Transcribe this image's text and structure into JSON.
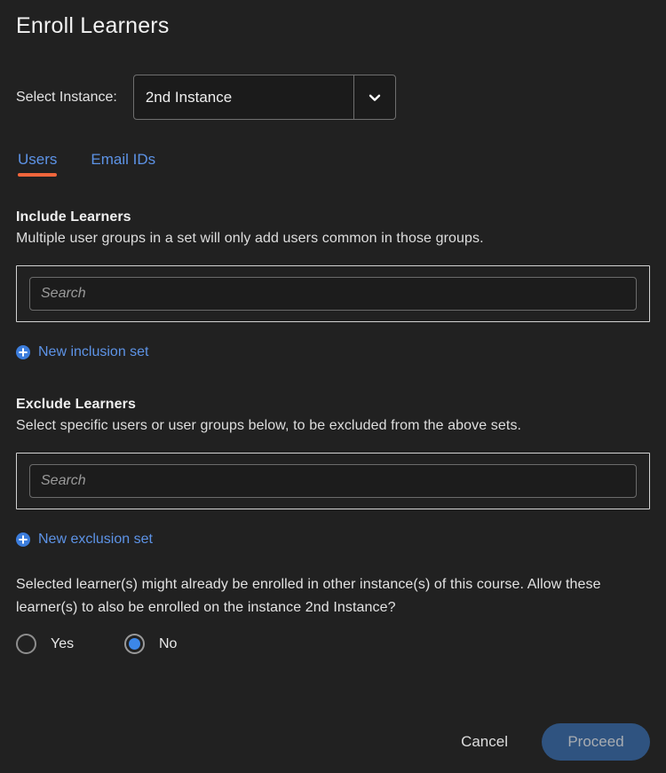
{
  "dialog": {
    "title": "Enroll Learners"
  },
  "instance": {
    "label": "Select Instance:",
    "selected": "2nd Instance",
    "arrow_icon": "chevron-down-icon"
  },
  "tabs": [
    {
      "label": "Users",
      "active": true
    },
    {
      "label": "Email IDs",
      "active": false
    }
  ],
  "include": {
    "heading": "Include Learners",
    "description": "Multiple user groups in a set will only add users common in those groups.",
    "search_placeholder": "Search",
    "search_value": "",
    "add_label": "New inclusion set",
    "add_icon": "plus-circle-icon"
  },
  "exclude": {
    "heading": "Exclude Learners",
    "description": "Select specific users or user groups below, to be excluded from the above sets.",
    "search_placeholder": "Search",
    "search_value": "",
    "add_label": "New exclusion set",
    "add_icon": "plus-circle-icon"
  },
  "allow_note": {
    "text": "Selected learner(s) might already be enrolled in other instance(s) of this course. Allow these learner(s) to also be enrolled on the instance 2nd Instance?",
    "options": [
      {
        "label": "Yes",
        "selected": false
      },
      {
        "label": "No",
        "selected": true
      }
    ]
  },
  "footer": {
    "cancel_label": "Cancel",
    "proceed_label": "Proceed"
  },
  "colors": {
    "background": "#212121",
    "accent_tab_underline": "#f2663c",
    "link_blue": "#5d93e6",
    "radio_blue": "#3c87e8",
    "proceed_bg": "#2f5380"
  }
}
